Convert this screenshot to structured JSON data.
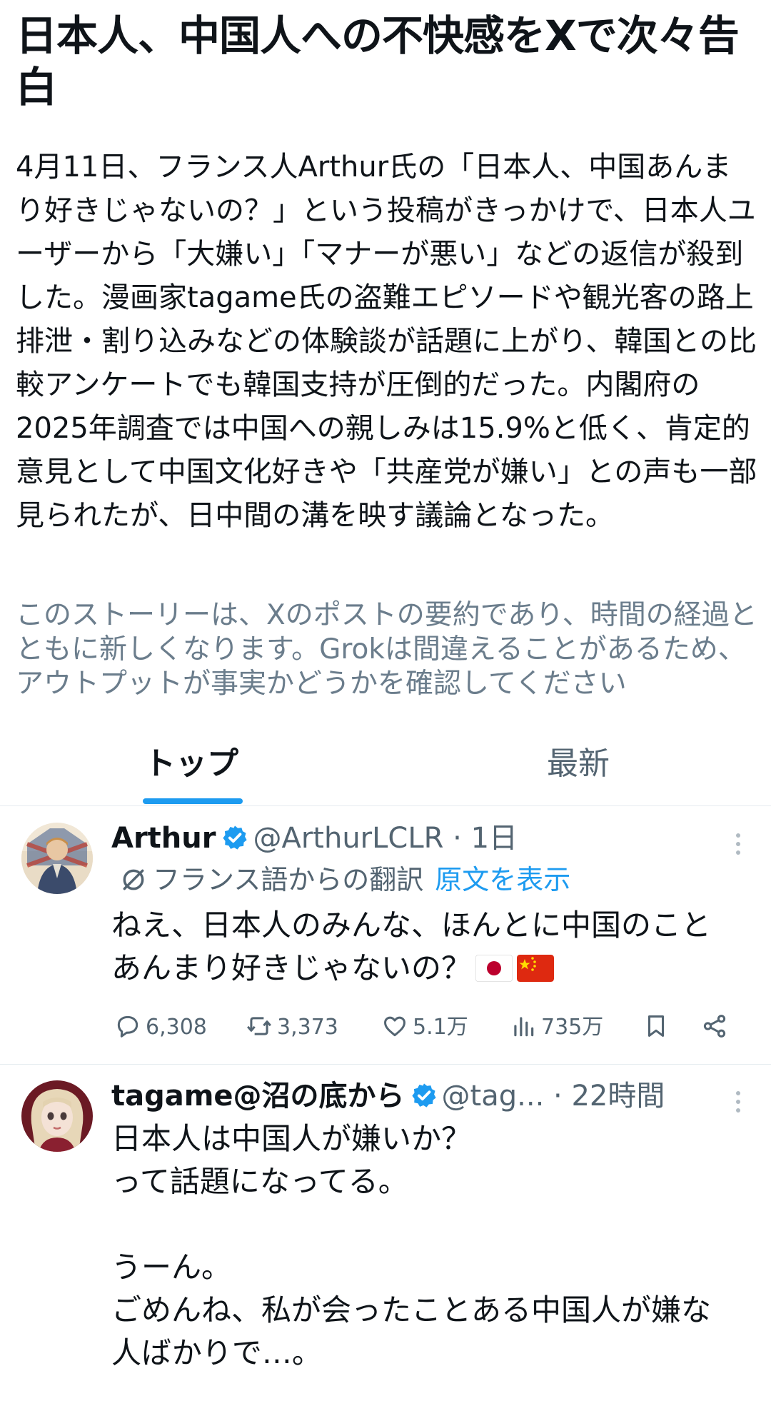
{
  "story": {
    "title": "日本人、中国人への不快感をXで次々告白",
    "summary": "4月11日、フランス人Arthur氏の「日本人、中国あんまり好きじゃないの？」という投稿がきっかけで、日本人ユーザーから「大嫌い」「マナーが悪い」などの返信が殺到した。漫画家tagame氏の盗難エピソードや観光客の路上排泄・割り込みなどの体験談が話題に上がり、韓国との比較アンケートでも韓国支持が圧倒的だった。内閣府の2025年調査では中国への親しみは15.9%と低く、肯定的意見として中国文化好きや「共産党が嫌い」との声も一部見られたが、日中間の溝を映す議論となった。",
    "disclaimer": "このストーリーは、Xのポストの要約であり、時間の経過とともに新しくなります。Grokは間違えることがあるため、アウトプットが事実かどうかを確認してください"
  },
  "tabs": {
    "top": "トップ",
    "latest": "最新"
  },
  "posts": [
    {
      "name": "Arthur",
      "handle": "@ArthurLCLR",
      "time": "1日",
      "translation_label": "フランス語からの翻訳",
      "show_original": "原文を表示",
      "text": "ねえ、日本人のみんな、ほんとに中国のことあんまり好きじゃないの？",
      "replies": "6,308",
      "reposts": "3,373",
      "likes": "5.1万",
      "views": "735万"
    },
    {
      "name": "tagame@沼の底から",
      "handle": "@tag...",
      "time": "22時間",
      "text": "日本人は中国人が嫌いか？\nって話題になってる。\n\nうーん。\nごめんね、私が会ったことある中国人が嫌な人ばかりで…。"
    }
  ],
  "colors": {
    "accent": "#1d9bf0",
    "text": "#0f1419",
    "muted": "#536471",
    "disclaimer": "#6b7d8c",
    "divider": "#e6ecf0"
  },
  "icons": [
    "verified-badge-icon",
    "translate-icon",
    "more-icon",
    "reply-icon",
    "repost-icon",
    "like-icon",
    "views-icon",
    "bookmark-icon",
    "share-icon",
    "japan-flag-icon",
    "china-flag-icon"
  ]
}
